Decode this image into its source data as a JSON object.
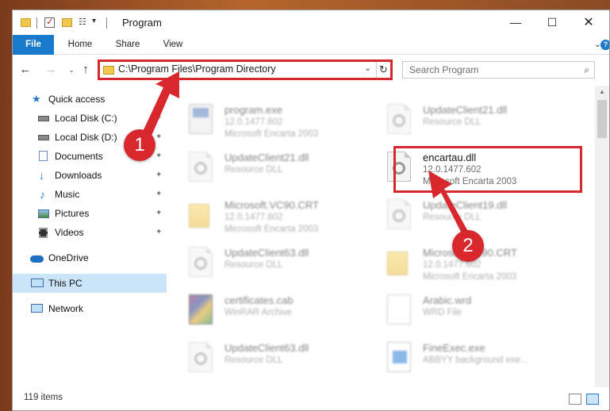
{
  "window": {
    "title": "Program",
    "minimize": "—",
    "maximize": "☐",
    "close": "✕"
  },
  "ribbon": {
    "tabs": [
      "File",
      "Home",
      "Share",
      "View"
    ],
    "expand": "⌄",
    "help": "?"
  },
  "nav": {
    "back": "←",
    "forward": "→",
    "recent": "⌄",
    "up": "↑",
    "address": "C:\\Program Files\\Program Directory",
    "address_dropdown": "⌄",
    "refresh": "↻",
    "search_placeholder": "Search Program",
    "search_icon": "⌕"
  },
  "sidebar": {
    "items": [
      {
        "label": "Quick access",
        "icon": "star-icon",
        "pinned": false
      },
      {
        "label": "Local Disk (C:)",
        "icon": "drive-icon",
        "pinned": true
      },
      {
        "label": "Local Disk (D:)",
        "icon": "drive-icon",
        "pinned": true
      },
      {
        "label": "Documents",
        "icon": "documents-icon",
        "pinned": true
      },
      {
        "label": "Downloads",
        "icon": "downloads-icon",
        "pinned": true
      },
      {
        "label": "Music",
        "icon": "music-icon",
        "pinned": true
      },
      {
        "label": "Pictures",
        "icon": "pictures-icon",
        "pinned": true
      },
      {
        "label": "Videos",
        "icon": "videos-icon",
        "pinned": true
      },
      {
        "label": "OneDrive",
        "icon": "onedrive-icon",
        "pinned": false
      },
      {
        "label": "This PC",
        "icon": "this-pc-icon",
        "pinned": false,
        "selected": true
      },
      {
        "label": "Network",
        "icon": "network-icon",
        "pinned": false
      }
    ],
    "pin_glyph": "📌"
  },
  "files": [
    {
      "name": "program.exe",
      "line1": "12.0.1477.602",
      "line2": "Microsoft Encarta 2003",
      "icon": "exe-icon",
      "blurred": true
    },
    {
      "name": "UpdateClient21.dll",
      "line1": "Resource DLL",
      "line2": "",
      "icon": "dll-icon",
      "blurred": true
    },
    {
      "name": "UpdateClient21.dll",
      "line1": "Resource DLL",
      "line2": "",
      "icon": "dll-icon",
      "blurred": true
    },
    {
      "name": "encartau.dll",
      "line1": "12.0.1477.602",
      "line2": "Microsoft Encarta 2003",
      "icon": "dll-icon",
      "blurred": false
    },
    {
      "name": "Microsoft.VC90.CRT",
      "line1": "12.0.1477.602",
      "line2": "Microsoft Encarta 2003",
      "icon": "folder-icon",
      "blurred": true
    },
    {
      "name": "UpdateClient19.dll",
      "line1": "Resource DLL",
      "line2": "",
      "icon": "dll-icon",
      "blurred": true
    },
    {
      "name": "UpdateClient63.dll",
      "line1": "Resource DLL",
      "line2": "",
      "icon": "dll-icon",
      "blurred": true
    },
    {
      "name": "Microsoft.VC90.CRT",
      "line1": "12.0.1477.602",
      "line2": "Microsoft Encarta 2003",
      "icon": "folder-icon",
      "blurred": true
    },
    {
      "name": "certificates.cab",
      "line1": "WinRAR Archive",
      "line2": "",
      "icon": "cab-icon",
      "blurred": true
    },
    {
      "name": "Arabic.wrd",
      "line1": "WRD File",
      "line2": "",
      "icon": "wrd-icon",
      "blurred": true
    },
    {
      "name": "UpdateClient63.dll",
      "line1": "Resource DLL",
      "line2": "",
      "icon": "dll-icon",
      "blurred": true
    },
    {
      "name": "FineExec.exe",
      "line1": "ABBYY background exe...",
      "line2": "",
      "icon": "exe-icon",
      "blurred": true
    }
  ],
  "status": {
    "count": "119 items"
  },
  "callouts": {
    "step1": "1",
    "step2": "2",
    "color": "#d9272e"
  }
}
